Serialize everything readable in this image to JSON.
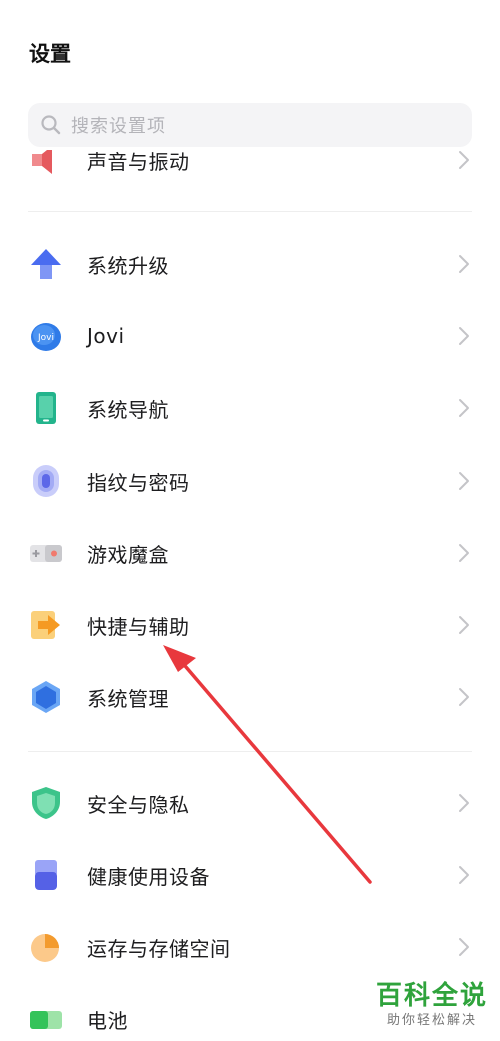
{
  "header": {
    "title": "设置"
  },
  "search": {
    "placeholder": "搜索设置项"
  },
  "items": {
    "sound": {
      "label": "声音与振动"
    },
    "system_upgrade": {
      "label": "系统升级"
    },
    "jovi": {
      "label": "Jovi",
      "icon_text": "Jovi"
    },
    "system_navigation": {
      "label": "系统导航"
    },
    "fingerprint_password": {
      "label": "指纹与密码"
    },
    "game_box": {
      "label": "游戏魔盒"
    },
    "shortcuts": {
      "label": "快捷与辅助"
    },
    "system_management": {
      "label": "系统管理"
    },
    "security_privacy": {
      "label": "安全与隐私"
    },
    "health_devices": {
      "label": "健康使用设备"
    },
    "memory_storage": {
      "label": "运存与存储空间"
    },
    "battery": {
      "label": "电池"
    }
  },
  "watermark": {
    "main": "百科全说",
    "sub": "助你轻松解决"
  },
  "colors": {
    "annotation_arrow": "#e8383d",
    "watermark_green": "#2fa33c"
  }
}
